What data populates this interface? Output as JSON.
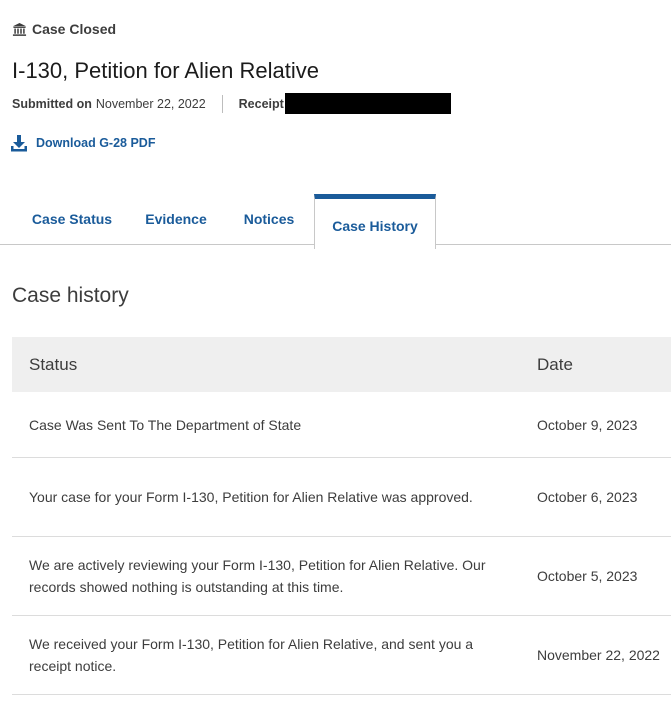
{
  "case": {
    "status": "Case Closed",
    "title": "I-130, Petition for Alien Relative",
    "submitted_label": "Submitted on",
    "submitted_date": "November 22, 2022",
    "receipt_label": "Receipt",
    "download_label": "Download G-28 PDF"
  },
  "tabs": [
    {
      "label": "Case Status"
    },
    {
      "label": "Evidence"
    },
    {
      "label": "Notices"
    },
    {
      "label": "Case History",
      "active": true
    }
  ],
  "history": {
    "title": "Case history",
    "headers": {
      "status": "Status",
      "date": "Date"
    },
    "rows": [
      {
        "status": "Case Was Sent To The Department of State",
        "date": "October 9, 2023"
      },
      {
        "status": "Your case for your Form I-130, Petition for Alien Relative was approved.",
        "date": "October 6, 2023"
      },
      {
        "status": "We are actively reviewing your Form I-130, Petition for Alien Relative. Our records showed nothing is outstanding at this time.",
        "date": "October 5, 2023"
      },
      {
        "status": "We received your Form I-130, Petition for Alien Relative, and sent you a receipt notice.",
        "date": "November 22, 2022"
      }
    ]
  },
  "colors": {
    "link": "#1a5b9a",
    "text": "#3d3d3d",
    "header_bg": "#efefef"
  },
  "icons": {
    "status": "bank-icon",
    "download": "download-icon"
  }
}
